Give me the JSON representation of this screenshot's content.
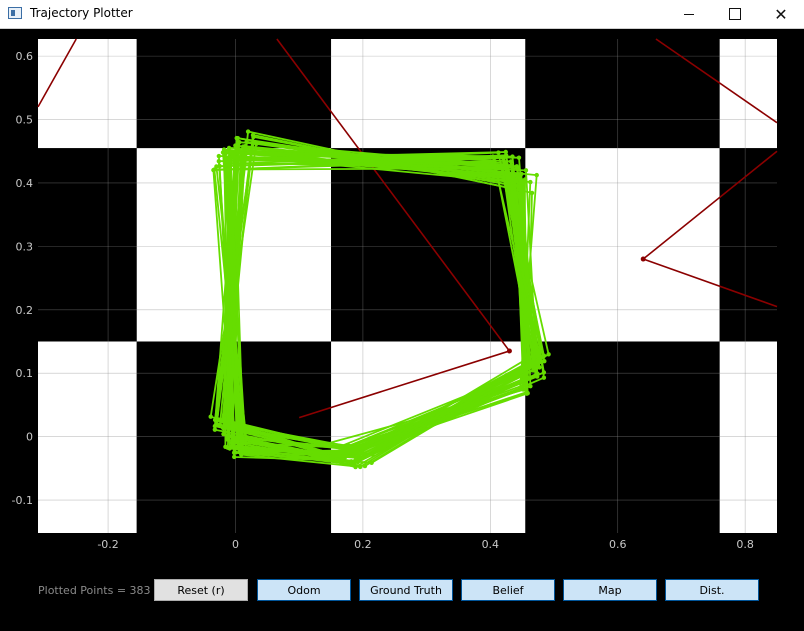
{
  "window": {
    "title": "Trajectory Plotter"
  },
  "status": {
    "plotted_points": "Plotted Points = 383"
  },
  "buttons": {
    "reset": "Reset (r)",
    "odom": "Odom",
    "ground_truth": "Ground Truth",
    "belief": "Belief",
    "map": "Map",
    "dist": "Dist."
  },
  "chart_data": {
    "type": "scatter",
    "x_ticks": [
      "-0.2",
      "0",
      "0.2",
      "0.4",
      "0.6",
      "0.8"
    ],
    "y_ticks": [
      "-0.1",
      "0",
      "0.1",
      "0.2",
      "0.3",
      "0.4",
      "0.5",
      "0.6"
    ],
    "xlim": [
      -0.31,
      0.85
    ],
    "ylim": [
      -0.152,
      0.627
    ],
    "grid": true,
    "background": "checkerboard",
    "checker_x_edges": [
      -0.31,
      -0.155,
      0.15,
      0.455,
      0.76,
      0.85
    ],
    "checker_y_edges": [
      -0.152,
      0.15,
      0.455,
      0.627
    ],
    "trajectory_color": "#66dd00",
    "ray_color": "#8b0000",
    "trajectory_loops": 40,
    "base_square": [
      [
        0.0,
        0.45
      ],
      [
        0.44,
        0.42
      ],
      [
        0.47,
        0.1
      ],
      [
        0.18,
        -0.03
      ],
      [
        -0.01,
        0.0
      ]
    ],
    "rays": [
      {
        "from": [
          0.1,
          0.03
        ],
        "to": [
          0.43,
          0.135
        ]
      },
      {
        "from": [
          0.43,
          0.135
        ],
        "to": [
          0.065,
          0.627
        ]
      },
      {
        "from": [
          0.64,
          0.28
        ],
        "to": [
          0.85,
          0.45
        ]
      },
      {
        "from": [
          0.64,
          0.28
        ],
        "to": [
          0.85,
          0.205
        ]
      },
      {
        "from": [
          -0.31,
          0.52
        ],
        "to": [
          -0.25,
          0.627
        ]
      },
      {
        "from": [
          0.66,
          0.627
        ],
        "to": [
          0.85,
          0.495
        ]
      }
    ]
  }
}
